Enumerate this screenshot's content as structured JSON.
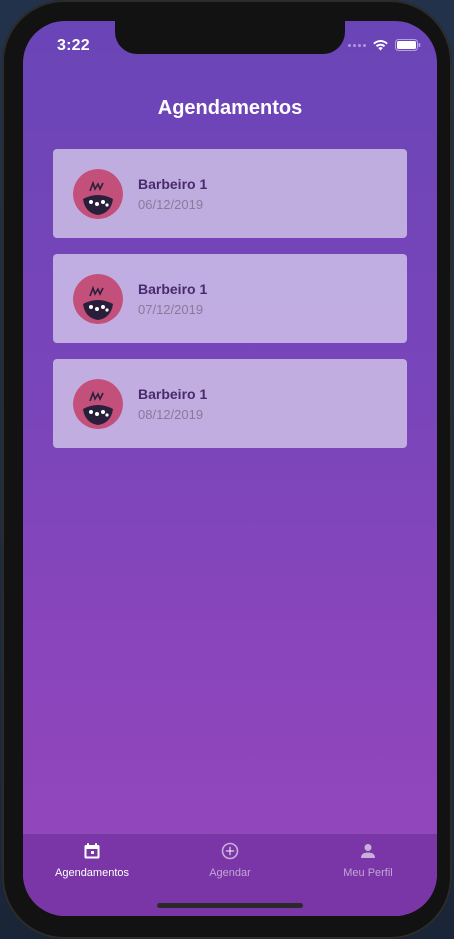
{
  "status_bar": {
    "time": "3:22"
  },
  "header": {
    "title": "Agendamentos"
  },
  "appointments": [
    {
      "name": "Barbeiro 1",
      "date": "06/12/2019"
    },
    {
      "name": "Barbeiro 1",
      "date": "07/12/2019"
    },
    {
      "name": "Barbeiro 1",
      "date": "08/12/2019"
    }
  ],
  "tabbar": {
    "items": [
      {
        "label": "Agendamentos",
        "icon": "calendar-icon",
        "active": true
      },
      {
        "label": "Agendar",
        "icon": "add-circle-icon",
        "active": false
      },
      {
        "label": "Meu Perfil",
        "icon": "person-icon",
        "active": false
      }
    ]
  },
  "colors": {
    "gradient_top": "#6a45b7",
    "gradient_bottom": "#9546bd",
    "card_background": "#ded6f0",
    "card_title": "#4a2a6e",
    "card_date": "#8a7a9a",
    "tabbar_background": "#7a35a6",
    "avatar_background": "#c2507a"
  }
}
